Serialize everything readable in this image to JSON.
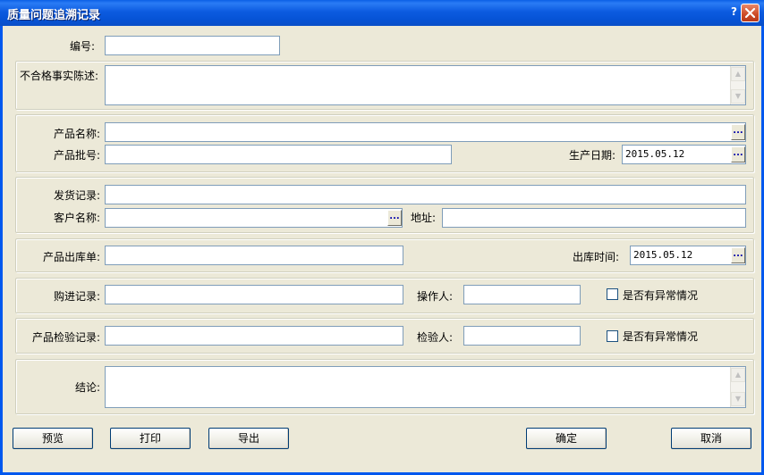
{
  "window": {
    "title": "质量问题追溯记录",
    "help_glyph": "?"
  },
  "fields": {
    "code_label": "编号:",
    "code_value": "",
    "nonconf_label": "不合格事实陈述:",
    "nonconf_value": "",
    "product_name_label": "产品名称:",
    "product_name_value": "",
    "batch_label": "产品批号:",
    "batch_value": "",
    "prod_date_label": "生产日期:",
    "prod_date_value": "2015.05.12",
    "ship_record_label": "发货记录:",
    "ship_record_value": "",
    "customer_label": "客户名称:",
    "customer_value": "",
    "address_label": "地址:",
    "address_value": "",
    "outbound_label": "产品出库单:",
    "outbound_value": "",
    "outbound_time_label": "出库时间:",
    "outbound_time_value": "2015.05.12",
    "purchase_label": "购进记录:",
    "purchase_value": "",
    "operator_label": "操作人:",
    "operator_value": "",
    "abnormal1_label": "是否有异常情况",
    "inspect_label": "产品检验记录:",
    "inspect_value": "",
    "inspector_label": "检验人:",
    "inspector_value": "",
    "abnormal2_label": "是否有异常情况",
    "conclusion_label": "结论:",
    "conclusion_value": ""
  },
  "buttons": {
    "preview": "预览",
    "print": "打印",
    "export": "导出",
    "ok": "确定",
    "cancel": "取消"
  },
  "icons": {
    "ellipsis": "...",
    "scroll_up": "▲",
    "scroll_down": "▼"
  }
}
